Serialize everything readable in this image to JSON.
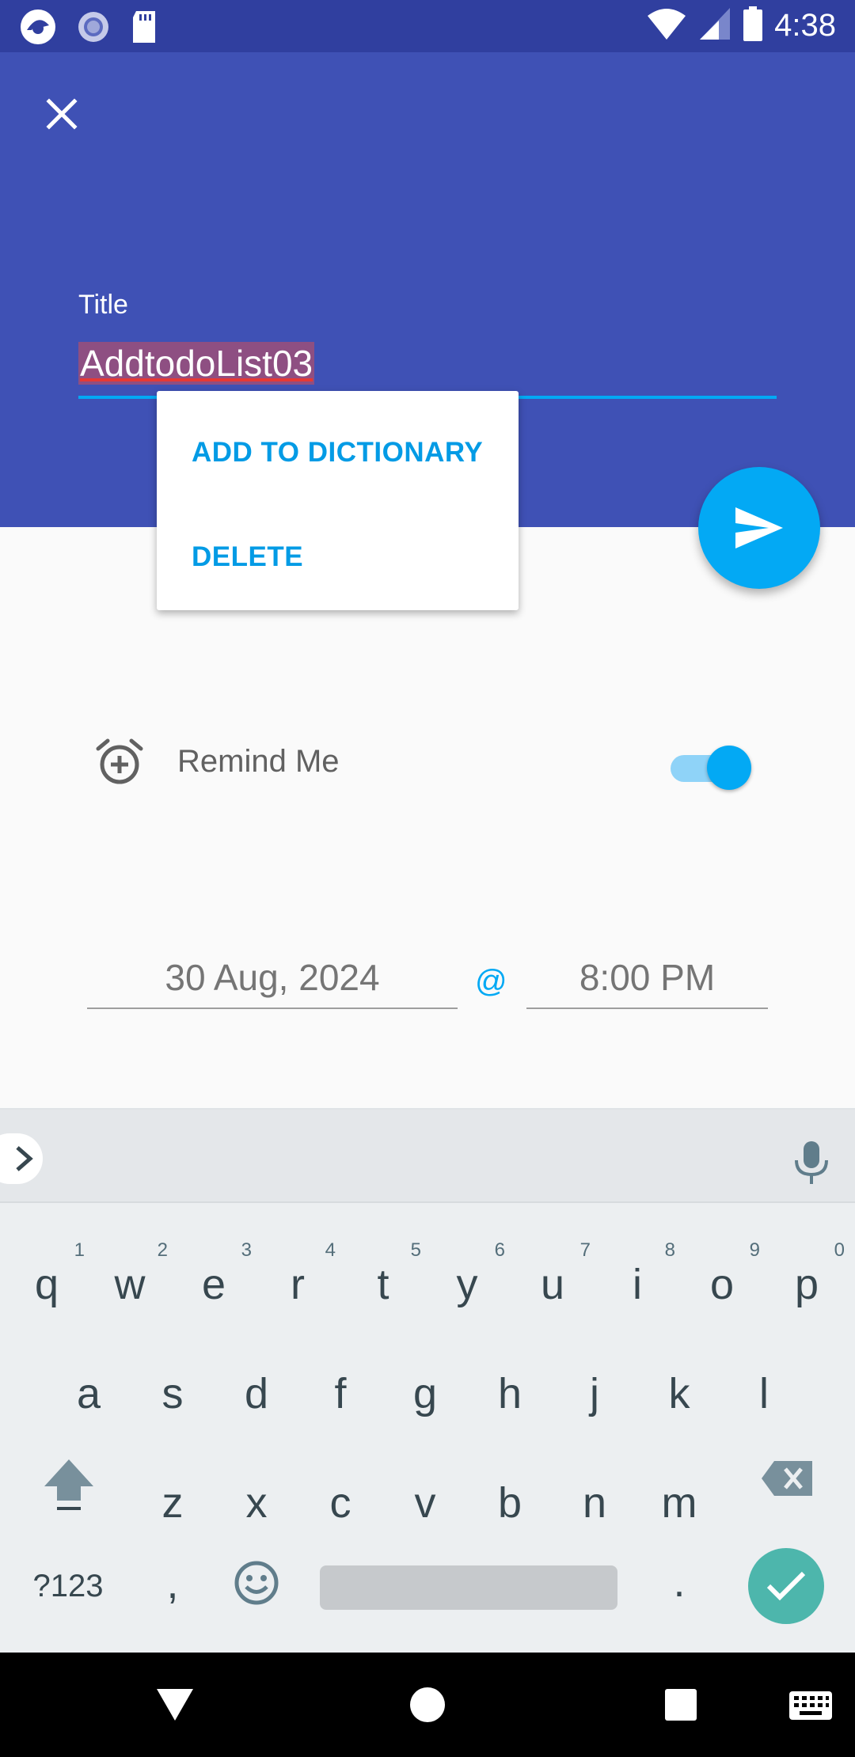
{
  "status_bar": {
    "time": "4:38",
    "left_icons": [
      "app-icon",
      "record-icon",
      "sd-card-icon"
    ],
    "right_icons": [
      "wifi-icon",
      "signal-icon",
      "battery-icon"
    ]
  },
  "header": {
    "title_label": "Title",
    "title_value": "AddtodoList03",
    "colors": {
      "primary": "#3f51b5",
      "primary_dark": "#303f9f",
      "accent": "#03a9f4"
    }
  },
  "popup_menu": {
    "items": [
      "ADD TO DICTIONARY",
      "DELETE"
    ]
  },
  "reminder": {
    "label": "Remind Me",
    "enabled": true
  },
  "schedule": {
    "date": "30 Aug, 2024",
    "separator": "@",
    "time": "8:00 PM"
  },
  "keyboard": {
    "row1": [
      {
        "key": "q",
        "hint": "1"
      },
      {
        "key": "w",
        "hint": "2"
      },
      {
        "key": "e",
        "hint": "3"
      },
      {
        "key": "r",
        "hint": "4"
      },
      {
        "key": "t",
        "hint": "5"
      },
      {
        "key": "y",
        "hint": "6"
      },
      {
        "key": "u",
        "hint": "7"
      },
      {
        "key": "i",
        "hint": "8"
      },
      {
        "key": "o",
        "hint": "9"
      },
      {
        "key": "p",
        "hint": "0"
      }
    ],
    "row2": [
      "a",
      "s",
      "d",
      "f",
      "g",
      "h",
      "j",
      "k",
      "l"
    ],
    "row3": [
      "z",
      "x",
      "c",
      "v",
      "b",
      "n",
      "m"
    ],
    "symbols_key": "?123",
    "comma_key": ",",
    "period_key": "."
  },
  "nav_bar": {
    "buttons": [
      "back-icon",
      "home-icon",
      "recents-icon",
      "keyboard-switch-icon"
    ]
  }
}
